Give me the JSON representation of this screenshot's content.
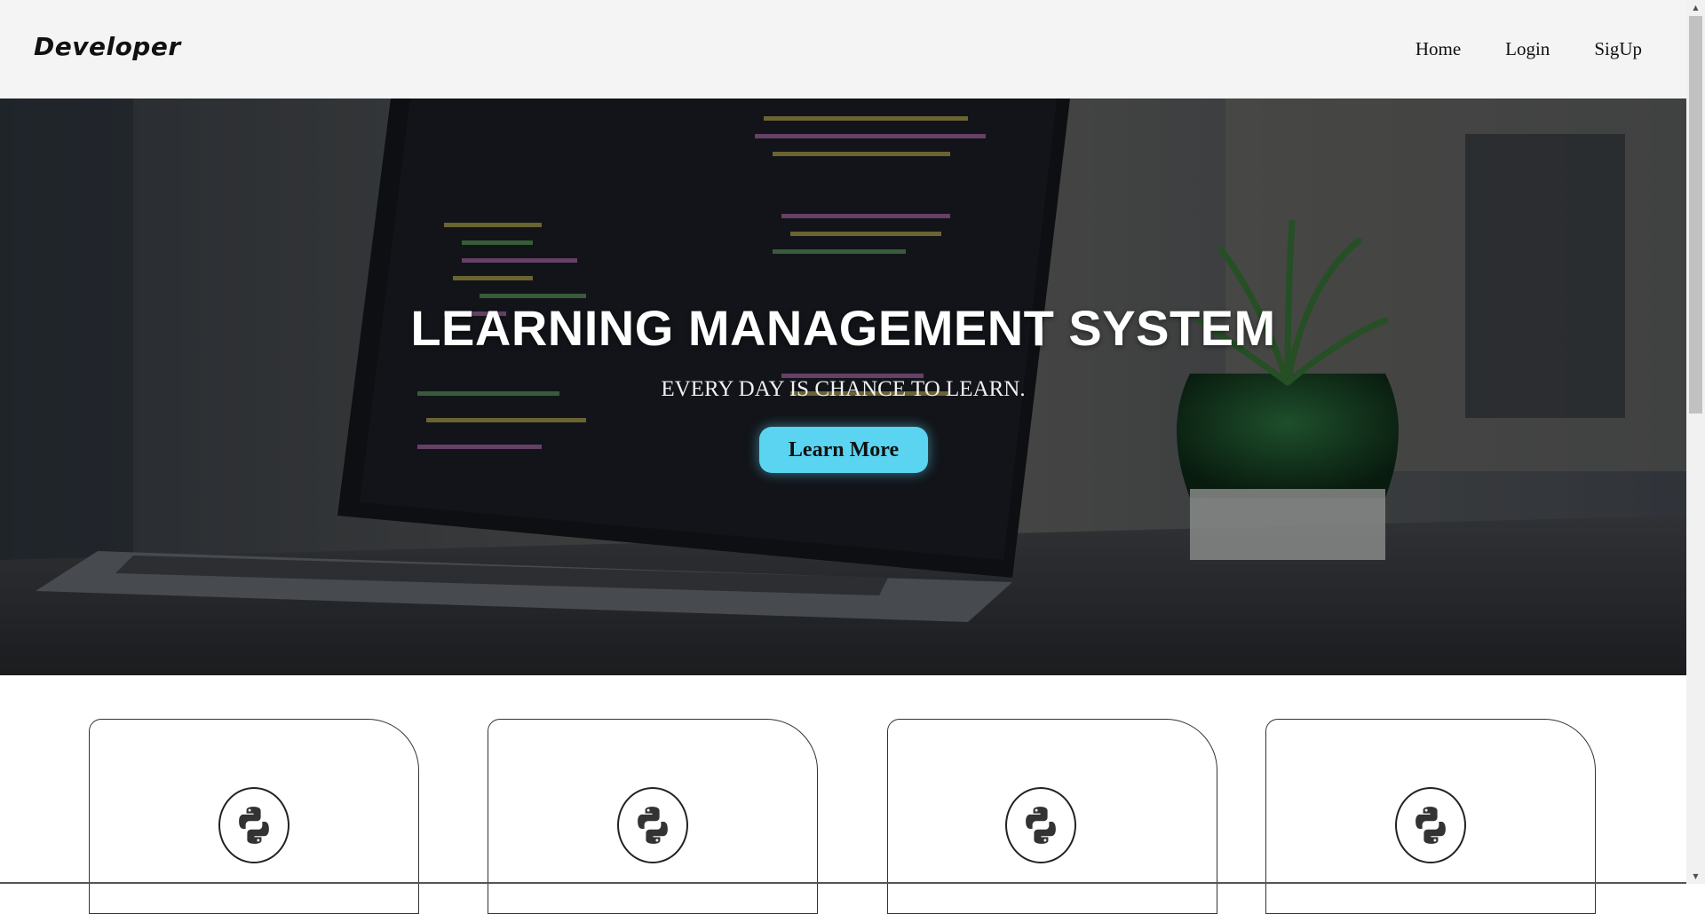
{
  "navbar": {
    "logo": "Developer",
    "links": [
      {
        "label": "Home"
      },
      {
        "label": "Login"
      },
      {
        "label": "SigUp"
      }
    ]
  },
  "hero": {
    "title": "LEARNING MANAGEMENT SYSTEM",
    "subtitle": "EVERY DAY IS CHANCE TO LEARN.",
    "cta_label": "Learn More"
  },
  "cards": [
    {
      "icon": "python-logo-icon"
    },
    {
      "icon": "python-logo-icon"
    },
    {
      "icon": "python-logo-icon"
    },
    {
      "icon": "python-logo-icon"
    }
  ],
  "colors": {
    "navbar_bg": "#f4f4f4",
    "cta_bg": "#5ad4f0",
    "hero_text": "#ffffff"
  }
}
